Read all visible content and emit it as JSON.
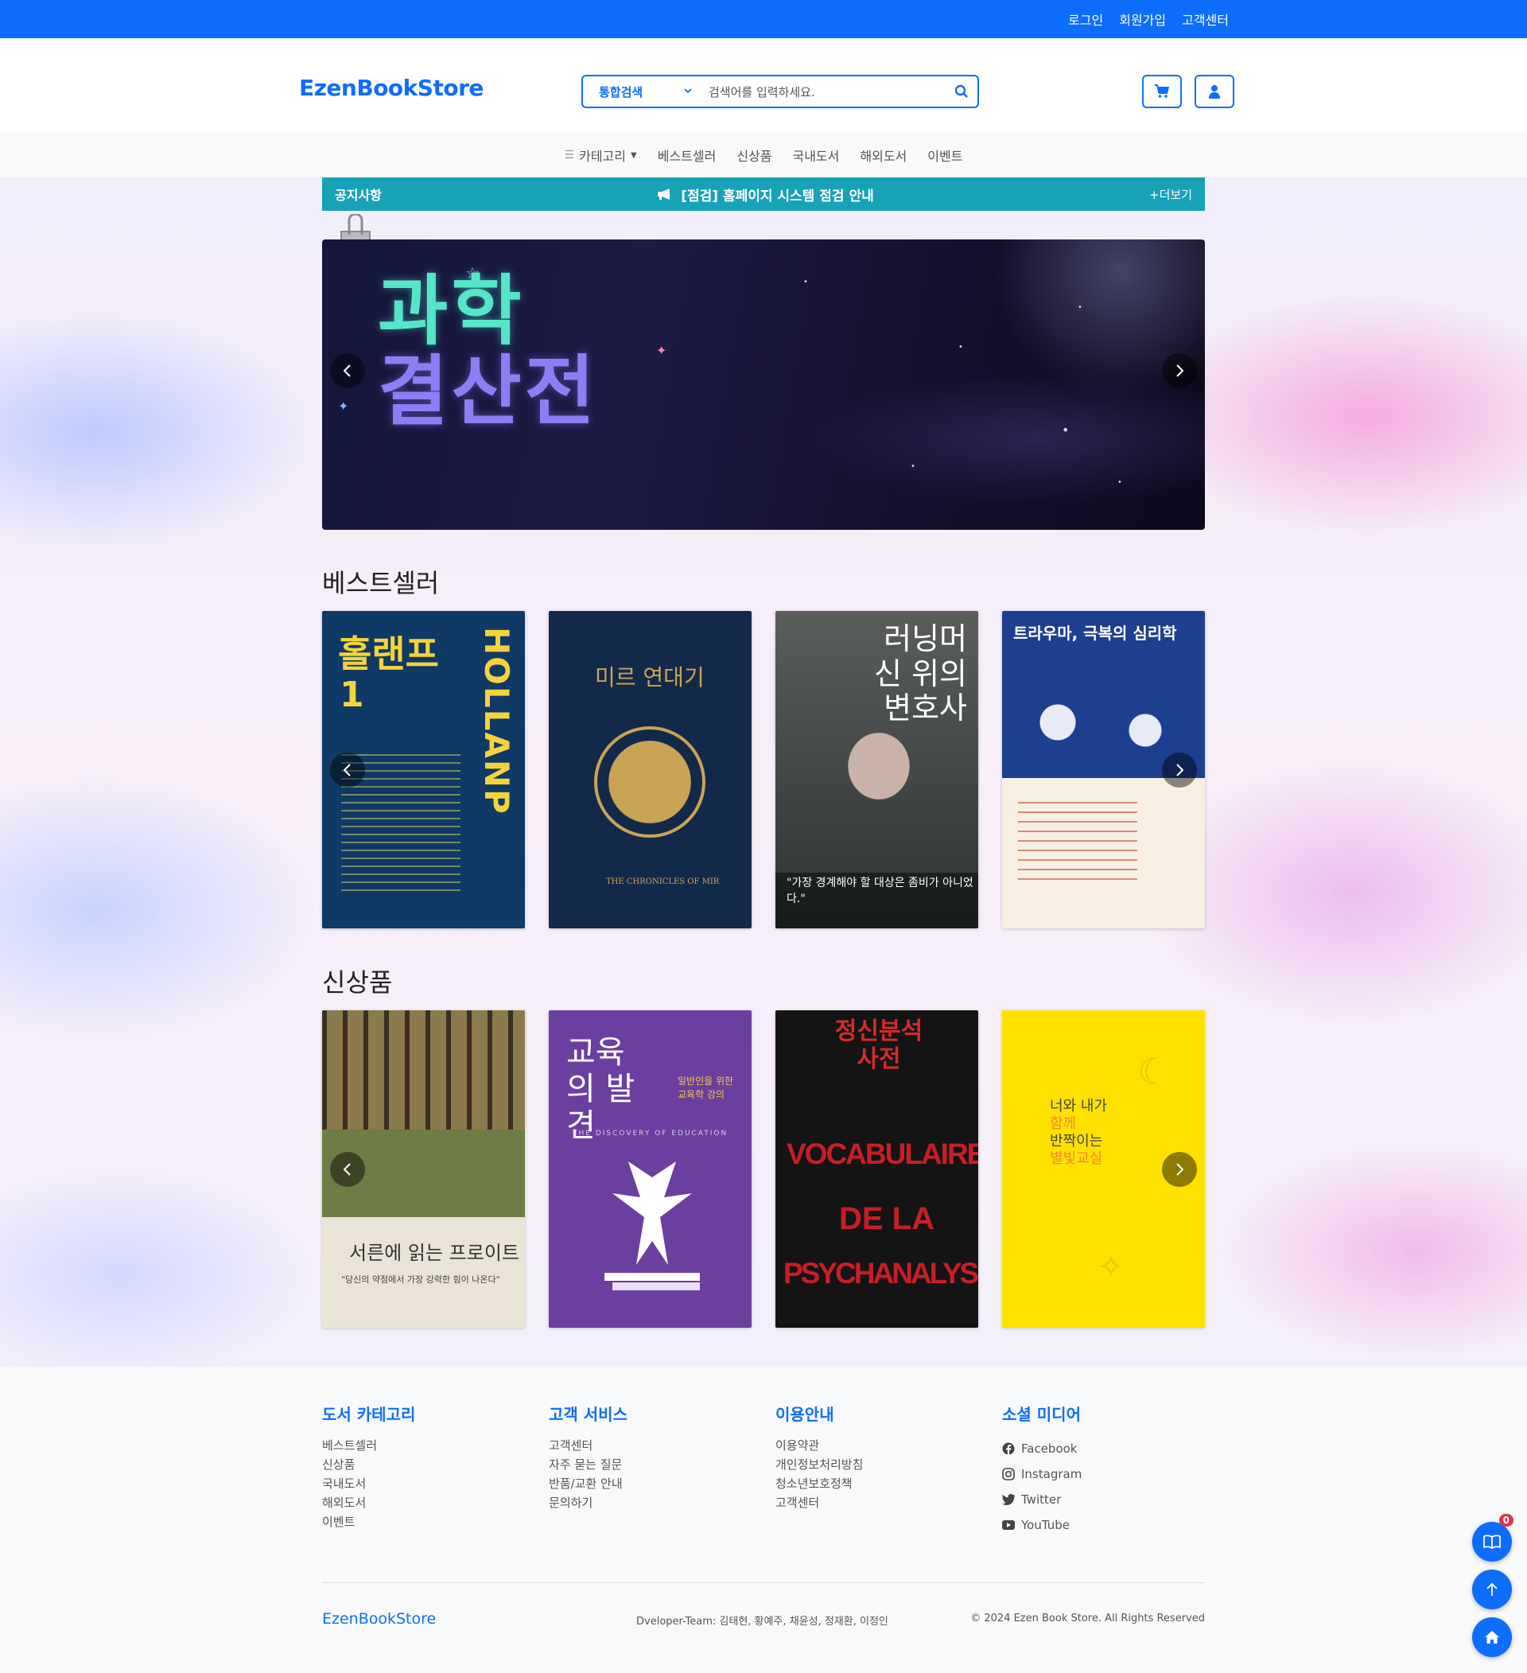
{
  "topbar": {
    "links": [
      "로그인",
      "회원가입",
      "고객센터"
    ],
    "color": "#0d6efd"
  },
  "header": {
    "logo": "EzenBookStore",
    "search": {
      "category": "통합검색",
      "placeholder": "검색어를 입력하세요."
    },
    "cart_icon": "cart-icon",
    "user_icon": "user-icon"
  },
  "nav": {
    "category_label": "카테고리",
    "items": [
      "베스트셀러",
      "신상품",
      "국내도서",
      "해외도서",
      "이벤트"
    ]
  },
  "notice": {
    "label": "공지사항",
    "text": "[점검] 홈페이지 시스템 점검 안내",
    "more": "+더보기"
  },
  "banner": {
    "line1": "과학",
    "line2": "결산전"
  },
  "bestseller": {
    "title": "베스트셀러",
    "books": [
      {
        "title": "홀랜프",
        "number": "1",
        "spine": "HOLLANP",
        "bg": "#0f3a66"
      },
      {
        "title": "미르 연대기",
        "subtitle": "THE CHRONICLES OF MIR",
        "bg": "#13294a"
      },
      {
        "title": "러닝머신 위의 변호사",
        "quote": "\"가장 경계해야 할 대상은 좀비가 아니었다.\"",
        "bg": "#6b6f6e"
      },
      {
        "title": "트라우마, 극복의 심리학",
        "bg": "#1d3f8f"
      }
    ]
  },
  "newitems": {
    "title": "신상품",
    "books": [
      {
        "title": "서른에 읽는 프로이트",
        "quote": "\"당신의 약점에서 가장 강력한 힘이 나온다\"",
        "bg": "#e9e4d6"
      },
      {
        "title": "교육의 발견",
        "subtitle": "일반인을 위한 교육학 강의",
        "en": "THE DISCOVERY OF EDUCATION",
        "bg": "#6a3fa0"
      },
      {
        "title": "정신분석 사전",
        "en1": "VOCABULAIRE",
        "en2": "DE LA",
        "en3": "PSYCHANALYSE",
        "bg": "#141414"
      },
      {
        "title_l1": "너와 내가",
        "title_l2": "함께",
        "title_l3": "반짝이는",
        "title_l4": "별빛교실",
        "bg": "#ffe100"
      }
    ]
  },
  "footer": {
    "cols": [
      {
        "title": "도서 카테고리",
        "links": [
          "베스트셀러",
          "신상품",
          "국내도서",
          "해외도서",
          "이벤트"
        ]
      },
      {
        "title": "고객 서비스",
        "links": [
          "고객센터",
          "자주 묻는 질문",
          "반품/교환 안내",
          "문의하기"
        ]
      },
      {
        "title": "이용안내",
        "links": [
          "이용약관",
          "개인정보처리방침",
          "청소년보호정책",
          "고객센터"
        ]
      },
      {
        "title": "소셜 미디어",
        "links": [
          "Facebook",
          "Instagram",
          "Twitter",
          "YouTube"
        ]
      }
    ],
    "brand": "EzenBookStore",
    "team": "Dveloper-Team: 김태현, 황예주, 채윤성, 정재환, 이정인",
    "copyright": "© 2024 Ezen Book Store. All Rights Reserved"
  },
  "floating": {
    "book_count": "0"
  }
}
